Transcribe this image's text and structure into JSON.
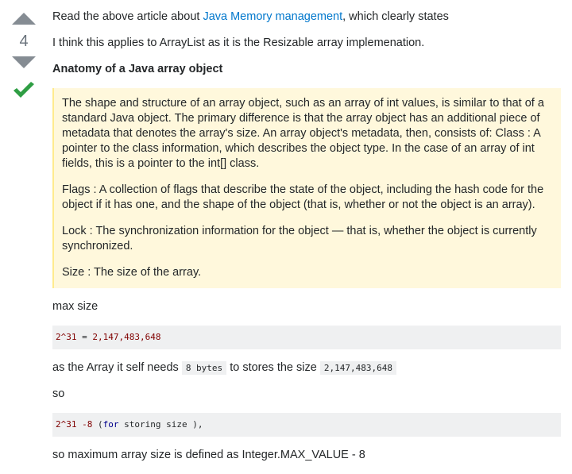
{
  "vote": {
    "count": "4"
  },
  "post": {
    "p1_before": "Read the above article about ",
    "p1_link": "Java Memory management",
    "p1_after": ", which clearly states",
    "p2": "I think this applies to ArrayList as it is the Resizable array implemenation.",
    "heading": "Anatomy of a Java array object",
    "quote": [
      "The shape and structure of an array object, such as an array of int values, is similar to that of a standard Java object. The primary difference is that the array object has an additional piece of metadata that denotes the array's size. An array object's metadata, then, consists of: Class : A pointer to the class information, which describes the object type. In the case of an array of int fields, this is a pointer to the int[] class.",
      "Flags : A collection of flags that describe the state of the object, including the hash code for the object if it has one, and the shape of the object (that is, whether or not the object is an array).",
      "Lock : The synchronization information for the object — that is, whether the object is currently synchronized.",
      "Size : The size of the array."
    ],
    "max_size": "max size",
    "code1": {
      "a": "2^31",
      "b": " = ",
      "c": "2,147,483,648"
    },
    "p3_before": "as the Array it self needs ",
    "p3_code1": "8 bytes",
    "p3_mid": " to stores the size ",
    "p3_code2": "2,147,483,648",
    "so": "so",
    "code2": {
      "a": "2^31",
      "b": " ",
      "c": "-8",
      "d": " (",
      "e": "for",
      "f": " storing size ),"
    },
    "last": "so maximum array size is defined as Integer.MAX_VALUE - 8"
  }
}
